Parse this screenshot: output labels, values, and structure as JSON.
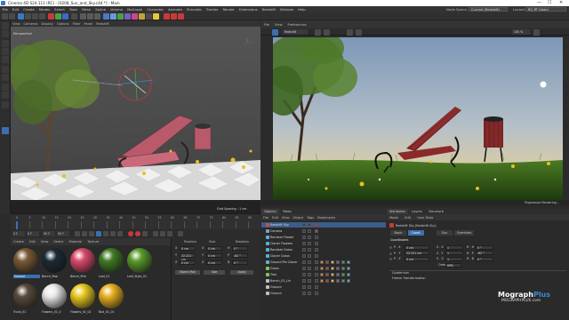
{
  "window": {
    "title": "Cinema 4D S24.111 (RC) - [0208_Sun_and_Sky.c4d *] - Main",
    "minimize": "—",
    "maximize": "☐",
    "close": "✕"
  },
  "menubar": {
    "items": [
      "File",
      "Edit",
      "Create",
      "Modes",
      "Select",
      "Tools",
      "Mesh",
      "Spline",
      "Volume",
      "MoGraph",
      "Character",
      "Animate",
      "Simulate",
      "Tracker",
      "Render",
      "Extensions",
      "Redshift",
      "Window",
      "Help"
    ],
    "node_space_label": "Node Space:",
    "node_space_value": "Current (Redshift)",
    "layout_label": "Layout:",
    "layout_value": "RS_RT (User)"
  },
  "viewport": {
    "menu": [
      "View",
      "Cameras",
      "Display",
      "Options",
      "Filter",
      "Panel",
      "Redshift"
    ],
    "label": "Perspective",
    "grid_spacing": "Grid Spacing : 1 cm"
  },
  "render_view": {
    "menu": [
      "File",
      "View",
      "Preferences"
    ],
    "camera_value": "Redshift",
    "zoom_value": "100 %",
    "status_left": "",
    "status_right": "Progressive Rendering..."
  },
  "timeline": {
    "ticks": [
      "0",
      "5",
      "10",
      "15",
      "20",
      "25",
      "30",
      "35",
      "40",
      "45",
      "50",
      "55",
      "60",
      "65",
      "70",
      "75",
      "80",
      "85",
      "90"
    ],
    "start_field": "0 F",
    "current_field": "0 F",
    "end_field": "90 F",
    "end_field2": "90 F"
  },
  "materials": {
    "menu": [
      "Create",
      "Edit",
      "View",
      "Select",
      "Material",
      "Texture"
    ],
    "items": [
      {
        "label": "Ground",
        "color": "#7a5a35"
      },
      {
        "label": "Bench_Pow",
        "color": "#1a2a33"
      },
      {
        "label": "Bench_Pink",
        "color": "#d84a6a"
      },
      {
        "label": "Leaf_01",
        "color": "#3f7a24"
      },
      {
        "label": "Leaf_Style_01",
        "color": "#5a9a2a"
      },
      {
        "label": "Trunk_01",
        "color": "#5a4a3a"
      },
      {
        "label": "Flowers_01_0",
        "color": "#e8e8e8"
      },
      {
        "label": "Flowers_01_02",
        "color": "#e8c820"
      },
      {
        "label": "Bud_01_01",
        "color": "#e8b020"
      }
    ]
  },
  "coordinates": {
    "headers": [
      "Position",
      "Size",
      "Rotation"
    ],
    "rows": [
      {
        "axis": "X",
        "pos": "0 cm",
        "size": "0 cm",
        "rot_axis": "H",
        "rot": "0 °"
      },
      {
        "axis": "Y",
        "pos": "22.221 cm",
        "size": "0 cm",
        "rot_axis": "P",
        "rot": "-62 °"
      },
      {
        "axis": "Z",
        "pos": "0 cm",
        "size": "0 cm",
        "rot_axis": "B",
        "rot": "0 °"
      }
    ],
    "mode_value": "Object (Rel)",
    "size_mode": "Size",
    "apply": "Apply"
  },
  "objects": {
    "tabs": [
      "Objects",
      "Takes"
    ],
    "menu": [
      "File",
      "Edit",
      "View",
      "Object",
      "Tags",
      "Bookmarks"
    ],
    "items": [
      {
        "name": "Redshift Sky",
        "color": "#d84a3a",
        "selected": true
      },
      {
        "name": "Camera",
        "color": "#7aa0c8",
        "selected": false
      },
      {
        "name": "Random Flower",
        "color": "#5ab0d8",
        "selected": false
      },
      {
        "name": "Cloner Flowers",
        "color": "#5ab0d8",
        "selected": false
      },
      {
        "name": "Random Grass",
        "color": "#5ab0d8",
        "selected": false
      },
      {
        "name": "Cloner Grass",
        "color": "#5ab0d8",
        "selected": false
      },
      {
        "name": "Ground Pie Cloner",
        "color": "#5ab0d8",
        "selected": false
      },
      {
        "name": "Grass",
        "color": "#8ac060",
        "selected": false
      },
      {
        "name": "Tree",
        "color": "#8ac060",
        "selected": false
      },
      {
        "name": "Bench_01_Lin",
        "color": "#c0c0c0",
        "selected": false
      },
      {
        "name": "Ground",
        "color": "#c0c0c0",
        "selected": false
      },
      {
        "name": "Ground",
        "color": "#c0c0c0",
        "selected": false
      }
    ]
  },
  "attributes": {
    "tabs": [
      "Attributes",
      "Layers",
      "Structure"
    ],
    "menu": [
      "Mode",
      "Edit",
      "User Data"
    ],
    "object_title": "Redshift Sky [Redshift Sky]",
    "subtabs": [
      "Basic",
      "Coord.",
      "Sun",
      "Overrides"
    ],
    "active_subtab": "Coord.",
    "section": "Coordinates",
    "rows": [
      {
        "p_label": "P . X",
        "p": "0 cm",
        "s_label": "S . X",
        "s": "1",
        "r_label": "R . H",
        "r": "0 °"
      },
      {
        "p_label": "P . Y",
        "p": "22.221 cm",
        "s_label": "S . Y",
        "s": "1",
        "r_label": "R . P",
        "r": "-62 °"
      },
      {
        "p_label": "P . Z",
        "p": "0 cm",
        "s_label": "S . Z",
        "s": "1",
        "r_label": "R . B",
        "r": "0 °"
      }
    ],
    "order_label": "Order",
    "order_value": "HPB",
    "quaternion": "Quaternion",
    "freeze": "Freeze Transformation"
  },
  "brand": {
    "name": "Mograph",
    "name_bold": "Plus",
    "url": "MOGRAPHPLUS.com"
  },
  "colors": {
    "accent": "#3b6fb0",
    "panel": "#2b2b2b",
    "sky_top": "#8aa2c0",
    "grass": "#3a6a18",
    "bench": "#8a2a2a"
  }
}
